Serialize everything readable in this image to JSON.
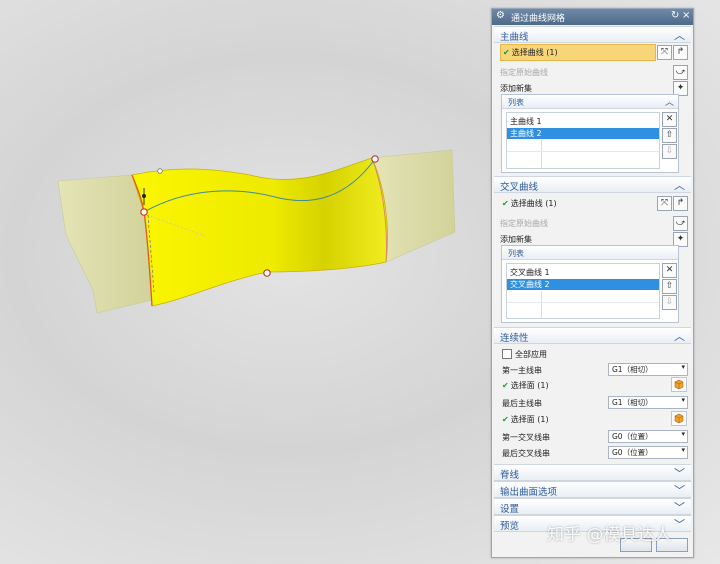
{
  "dialog": {
    "title": "通过曲线网格",
    "primary": {
      "header": "主曲线",
      "select_curve": "选择曲线 (1)",
      "specify_origin": "指定原始曲线",
      "add_new_set": "添加新集",
      "list_header": "列表",
      "items": [
        "主曲线 1",
        "主曲线 2"
      ],
      "selected_index": 1
    },
    "cross": {
      "header": "交叉曲线",
      "select_curve": "选择曲线 (1)",
      "specify_origin": "指定原始曲线",
      "add_new_set": "添加新集",
      "list_header": "列表",
      "items": [
        "交叉曲线 1",
        "交叉曲线 2"
      ],
      "selected_index": 1
    },
    "continuity": {
      "header": "连续性",
      "apply_all": "全部应用",
      "first_primary_label": "第一主线串",
      "first_primary_value": "G1（相切）",
      "select_face_1": "选择面 (1)",
      "last_primary_label": "最后主线串",
      "last_primary_value": "G1（相切）",
      "select_face_2": "选择面 (1)",
      "first_cross_label": "第一交叉线串",
      "first_cross_value": "G0（位置）",
      "last_cross_label": "最后交叉线串",
      "last_cross_value": "G0（位置）"
    },
    "collapsed_sections": [
      "脊线",
      "输出曲面选项",
      "设置",
      "预览"
    ]
  },
  "watermark": "知乎 @模具达人",
  "colors": {
    "surface_yellow": "#f5f000",
    "surface_base": "#dcdca4",
    "title_blue": "#4e6a8a",
    "selection_blue": "#2f8fe0",
    "highlight_orange": "#f9d57a"
  }
}
